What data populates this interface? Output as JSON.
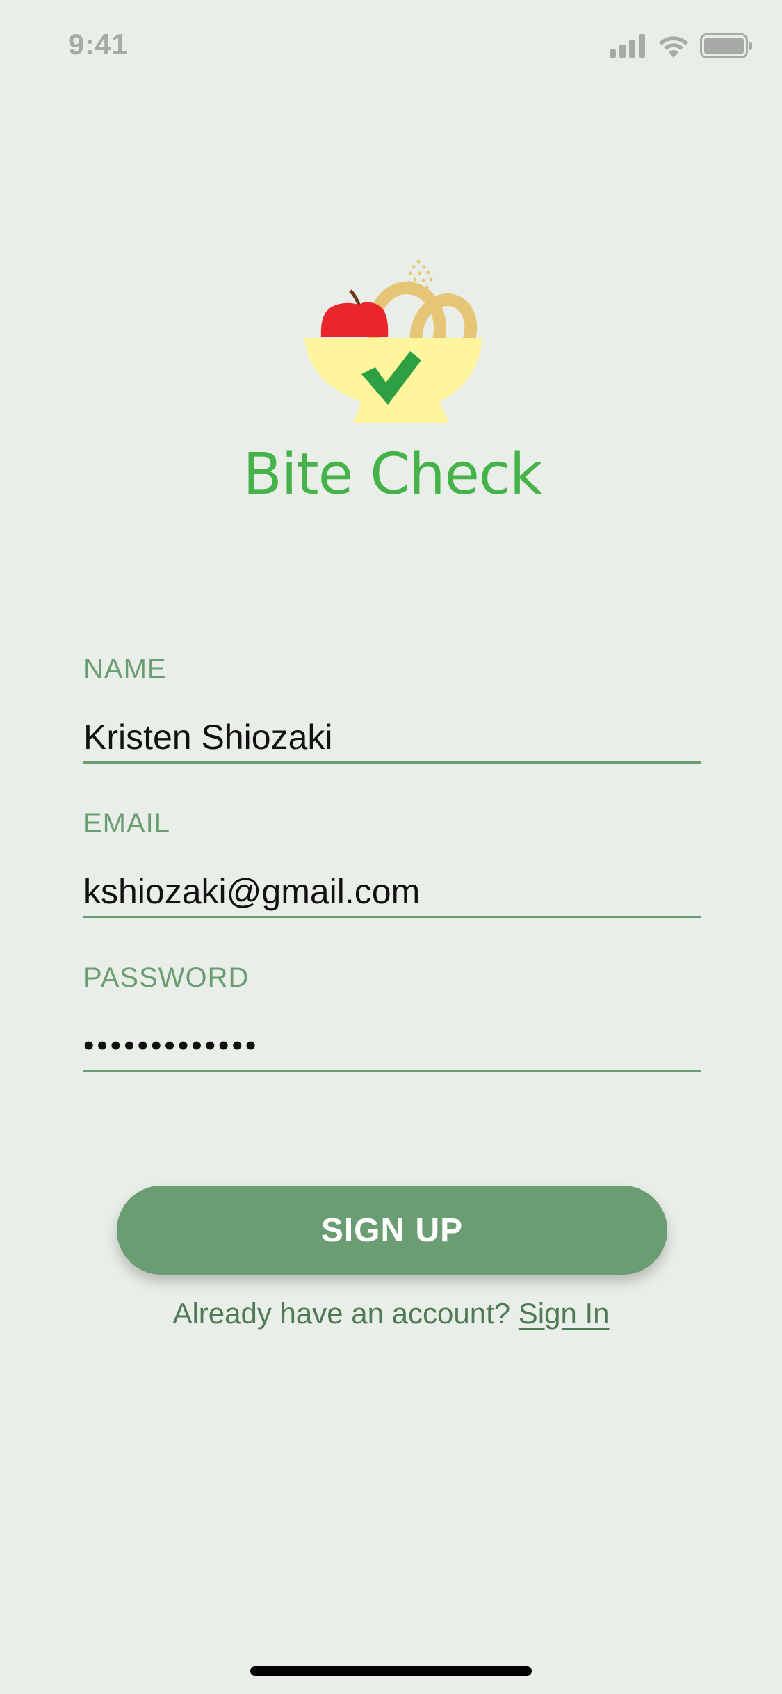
{
  "status_bar": {
    "time": "9:41",
    "icons": [
      "cellular-signal-icon",
      "wifi-icon",
      "battery-icon"
    ]
  },
  "logo": {
    "app_name": "Bite Check",
    "brand_color": "#45B349",
    "icon": "food-bowl-check-icon"
  },
  "form": {
    "name": {
      "label": "NAME",
      "value": "Kristen Shiozaki"
    },
    "email": {
      "label": "EMAIL",
      "value": "kshiozaki@gmail.com"
    },
    "password": {
      "label": "PASSWORD",
      "value": "•••••••••••••"
    }
  },
  "actions": {
    "signup_label": "SIGN UP",
    "signin_prompt": "Already have an account?",
    "signin_link": "Sign In"
  },
  "colors": {
    "background": "#EAEEE8",
    "accent": "#6A9E72",
    "label": "#6A9E72"
  }
}
